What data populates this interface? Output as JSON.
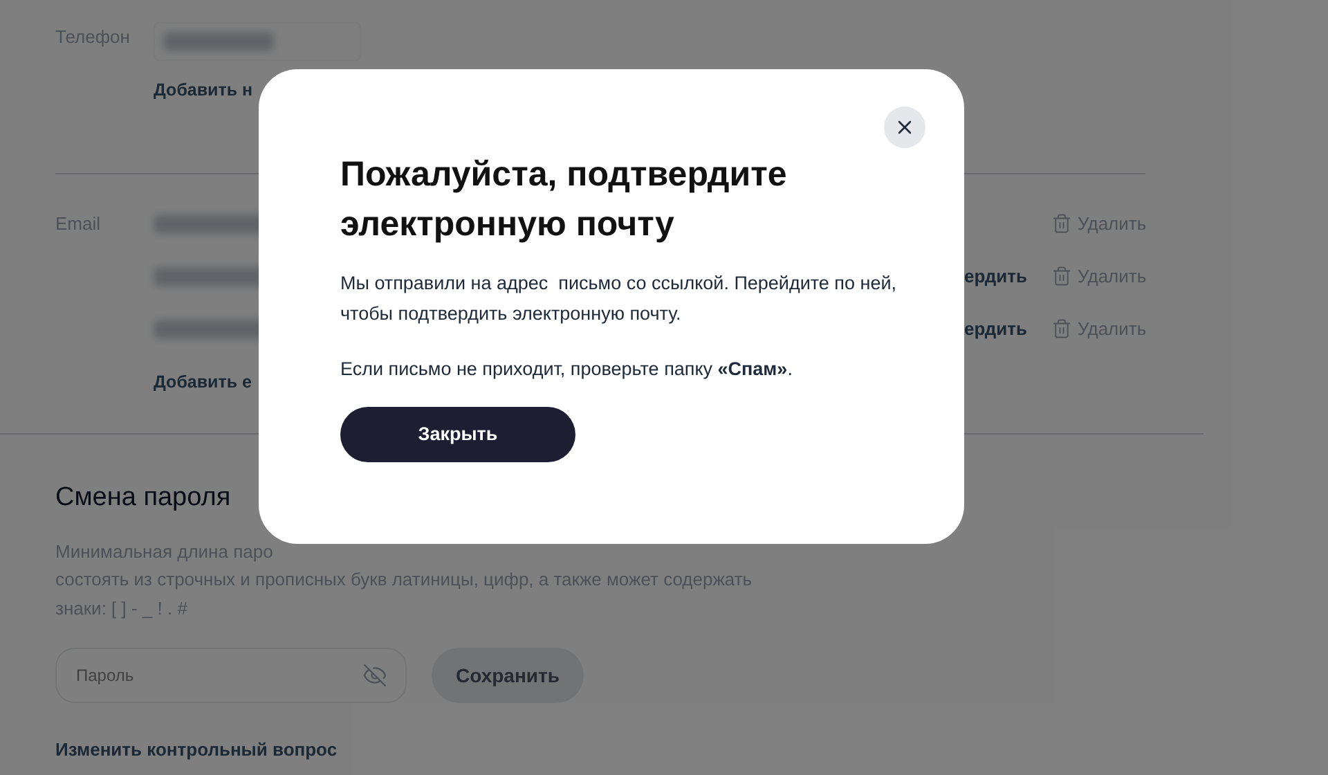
{
  "phone": {
    "label": "Телефон",
    "add_link": "Добавить н"
  },
  "email": {
    "label": "Email",
    "rows": [
      {
        "delete": "Удалить"
      },
      {
        "confirm": "ердить",
        "delete": "Удалить"
      },
      {
        "confirm": "ердить",
        "delete": "Удалить"
      }
    ],
    "add_link": "Добавить е"
  },
  "password": {
    "title": "Смена пароля",
    "description_lines": [
      "Минимальная длина паро",
      "состоять из строчных и прописных букв латиницы, цифр, а также может содержать",
      "знаки: [ ] - _ ! . #"
    ],
    "placeholder": "Пароль",
    "save_button": "Сохранить",
    "security_question_link": "Изменить контрольный вопрос"
  },
  "dialog": {
    "title": "Пожалуйста, подтвердите электронную почту",
    "message": "Мы отправили на адрес  письмо со ссылкой. Перейдите по ней, чтобы подтвердить электронную почту.",
    "note": "Если письмо не приходит, проверьте папку **«Спам»**.",
    "button": "Закрыть"
  }
}
